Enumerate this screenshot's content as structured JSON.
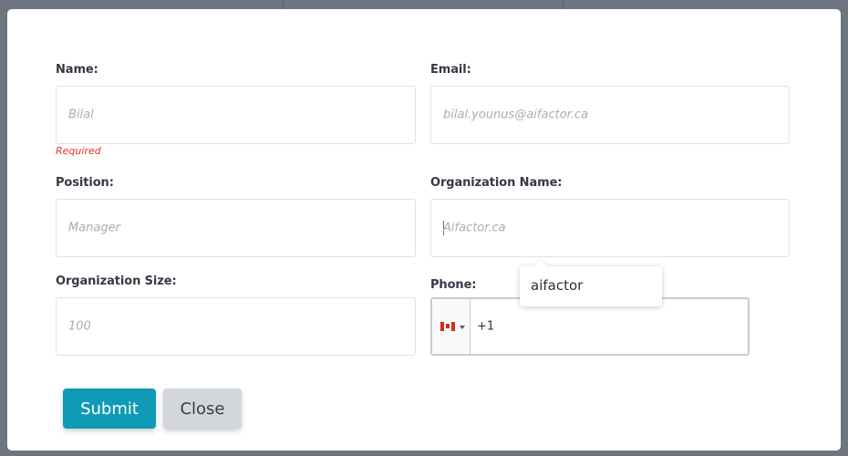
{
  "form": {
    "name": {
      "label": "Name:",
      "placeholder": "Bilal",
      "error": "Required"
    },
    "email": {
      "label": "Email:",
      "placeholder": "bilal.younus@aifactor.ca"
    },
    "position": {
      "label": "Position:",
      "placeholder": "Manager"
    },
    "organization_name": {
      "label": "Organization Name:",
      "placeholder": "Aifactor.ca"
    },
    "organization_size": {
      "label": "Organization Size:",
      "placeholder": "100"
    },
    "phone": {
      "label": "Phone:",
      "country_icon": "canada-flag-icon",
      "dial_code": "+1"
    },
    "autocomplete": {
      "suggestion": "aifactor"
    }
  },
  "buttons": {
    "submit": "Submit",
    "close": "Close"
  },
  "colors": {
    "accent": "#0f9bb5",
    "error": "#e3342f",
    "close_button": "#d3d6da"
  }
}
